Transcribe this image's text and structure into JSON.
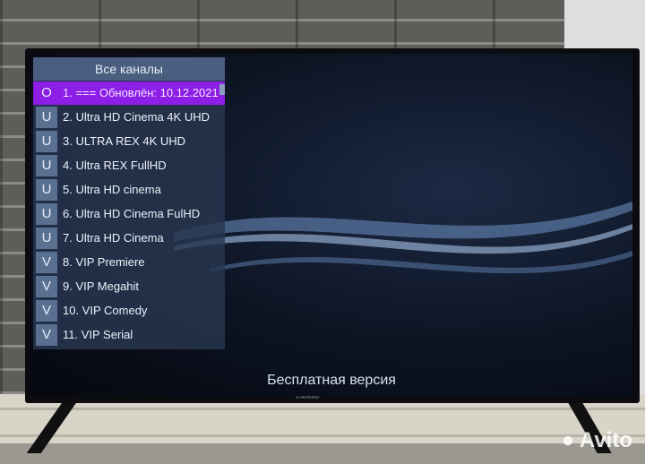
{
  "panel": {
    "title": "Все каналы",
    "items": [
      {
        "letter": "O",
        "label": "1. === Обновлён: 10.12.2021",
        "selected": true
      },
      {
        "letter": "U",
        "label": "2. Ultra HD Cinema 4K UHD"
      },
      {
        "letter": "U",
        "label": "3. ULTRA REX 4K UHD"
      },
      {
        "letter": "U",
        "label": "4. Ultra REX FullHD"
      },
      {
        "letter": "U",
        "label": "5. Ultra HD cinema"
      },
      {
        "letter": "U",
        "label": "6. Ultra HD Cinema FulHD"
      },
      {
        "letter": "U",
        "label": "7. Ultra HD Cinema"
      },
      {
        "letter": "V",
        "label": "8. VIP Premiere"
      },
      {
        "letter": "V",
        "label": "9. VIP Megahit"
      },
      {
        "letter": "V",
        "label": "10. VIP Comedy"
      },
      {
        "letter": "V",
        "label": "11. VIP Serial"
      }
    ]
  },
  "footer": "Бесплатная версия",
  "tv_brand": "STARWIND",
  "watermark": "Avito",
  "colors": {
    "selected": "#8d1ee6",
    "panel": "#283750"
  }
}
